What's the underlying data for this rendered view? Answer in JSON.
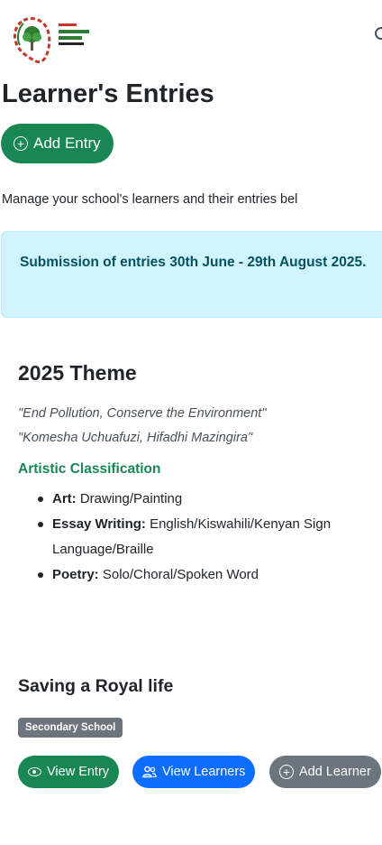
{
  "header": {
    "logo_alt": "Hon. Lubna's Mazingira Awards logo"
  },
  "page": {
    "title": "Learner's Entries",
    "add_entry_label": "Add Entry",
    "intro": "Manage your school's learners and their entries bel"
  },
  "notice": {
    "text": "Submission of entries 30th June - 29th August 2025."
  },
  "theme": {
    "title": "2025 Theme",
    "quote_en": "\"End Pollution, Conserve the Environment\"",
    "quote_sw": "\"Komesha Uchuafuzi, Hifadhi Mazingira\"",
    "classification_title": "Artistic Classification",
    "items": [
      {
        "label": "Art:",
        "value": " Drawing/Painting"
      },
      {
        "label": "Essay Writing:",
        "value": " English/Kiswahili/Kenyan Sign Language/Braille"
      },
      {
        "label": "Poetry:",
        "value": " Solo/Choral/Spoken Word"
      }
    ]
  },
  "entry": {
    "title": "Saving a Royal life",
    "level_badge": "Secondary School",
    "view_entry_label": "View Entry",
    "view_learners_label": "View Learners",
    "add_learner_label": "Add Learner"
  },
  "colors": {
    "success": "#198754",
    "primary": "#0d6efd",
    "secondary": "#6c757d",
    "alert_bg": "#cff4fc",
    "alert_text": "#055160"
  }
}
